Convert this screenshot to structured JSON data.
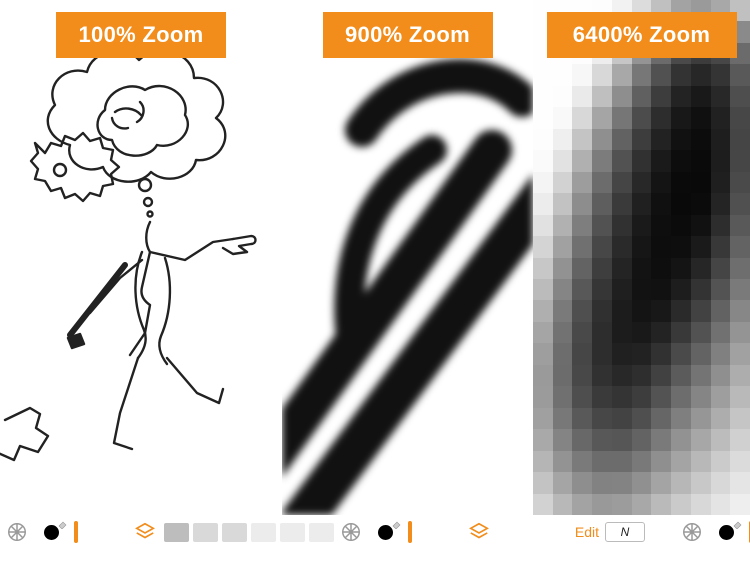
{
  "panels": [
    {
      "zoom_label": "100% Zoom"
    },
    {
      "zoom_label": "900% Zoom"
    },
    {
      "zoom_label": "6400% Zoom"
    }
  ],
  "toolbar": {
    "edit_label": "Edit",
    "n_label": "N"
  },
  "pixel_grid": {
    "cols": 11,
    "rows": 24,
    "shades": [
      "fefefe",
      "fefefe",
      "fefefe",
      "fdfdfd",
      "f2f2f2",
      "dcdcdc",
      "c0c0c0",
      "a3a3a3",
      "9a9a9a",
      "a8a8a8",
      "c0c0c0",
      "fefefe",
      "fefefe",
      "fefefe",
      "f8f8f8",
      "dedede",
      "b5b5b5",
      "8f8f8f",
      "6f6f6f",
      "616161",
      "6a6a6a",
      "8a8a8a",
      "fefefe",
      "fefefe",
      "fdfdfd",
      "ededed",
      "c6c6c6",
      "949494",
      "6b6b6b",
      "4a4a4a",
      "3c3c3c",
      "474747",
      "6b6b6b",
      "fefefe",
      "fefefe",
      "f7f7f7",
      "d8d8d8",
      "a8a8a8",
      "777777",
      "515151",
      "333333",
      "272727",
      "343434",
      "595959",
      "fefefe",
      "fdfdfd",
      "eaeaea",
      "bfbfbf",
      "8e8e8e",
      "606060",
      "3d3d3d",
      "232323",
      "191919",
      "282828",
      "4e4e4e",
      "fefefe",
      "f9f9f9",
      "d8d8d8",
      "a5a5a5",
      "767676",
      "4c4c4c",
      "2d2d2d",
      "181818",
      "101010",
      "212121",
      "474747",
      "fdfdfd",
      "efefef",
      "c4c4c4",
      "8f8f8f",
      "626262",
      "3d3d3d",
      "222222",
      "111111",
      "0c0c0c",
      "1e1e1e",
      "454545",
      "fafafa",
      "e2e2e2",
      "b0b0b0",
      "7c7c7c",
      "525252",
      "313131",
      "1a1a1a",
      "0d0d0d",
      "0a0a0a",
      "1d1d1d",
      "464646",
      "f4f4f4",
      "d2d2d2",
      "9d9d9d",
      "6c6c6c",
      "454545",
      "282828",
      "141414",
      "0a0a0a",
      "090909",
      "1f1f1f",
      "4a4a4a",
      "ececec",
      "c2c2c2",
      "8d8d8d",
      "5e5e5e",
      "3a3a3a",
      "202020",
      "101010",
      "090909",
      "0b0b0b",
      "242424",
      "505050",
      "e1e1e1",
      "b1b1b1",
      "7e7e7e",
      "525252",
      "313131",
      "1a1a1a",
      "0e0e0e",
      "0b0b0b",
      "111111",
      "2d2d2d",
      "595959",
      "d4d4d4",
      "a1a1a1",
      "707070",
      "474747",
      "2a2a2a",
      "161616",
      "0d0d0d",
      "0e0e0e",
      "1a1a1a",
      "383838",
      "636363",
      "c7c7c7",
      "929292",
      "636363",
      "3e3e3e",
      "242424",
      "131313",
      "0e0e0e",
      "141414",
      "262626",
      "454545",
      "6e6e6e",
      "bbbbbb",
      "858585",
      "585858",
      "363636",
      "1f1f1f",
      "121212",
      "111111",
      "1d1d1d",
      "333333",
      "535353",
      "7a7a7a",
      "afafaf",
      "7a7a7a",
      "4f4f4f",
      "303030",
      "1c1c1c",
      "141414",
      "181818",
      "2a2a2a",
      "424242",
      "626262",
      "878787",
      "a5a5a5",
      "727272",
      "494949",
      "2d2d2d",
      "1c1c1c",
      "191919",
      "232323",
      "393939",
      "525252",
      "717171",
      "949494",
      "9e9e9e",
      "6d6d6d",
      "464646",
      "2d2d2d",
      "202020",
      "222222",
      "313131",
      "4a4a4a",
      "636363",
      "808080",
      "a1a1a1",
      "9a9a9a",
      "6c6c6c",
      "484848",
      "313131",
      "282828",
      "2e2e2e",
      "414141",
      "5b5b5b",
      "747474",
      "8f8f8f",
      "adadad",
      "9b9b9b",
      "707070",
      "4e4e4e",
      "3a3a3a",
      "343434",
      "3d3d3d",
      "535353",
      "6d6d6d",
      "858585",
      "9e9e9e",
      "b9b9b9",
      "a0a0a0",
      "787878",
      "595959",
      "474747",
      "434343",
      "4f4f4f",
      "666666",
      "7f7f7f",
      "969696",
      "adadad",
      "c5c5c5",
      "a9a9a9",
      "848484",
      "686868",
      "585858",
      "565656",
      "636363",
      "7a7a7a",
      "929292",
      "a7a7a7",
      "bcbcbc",
      "d0d0d0",
      "b5b5b5",
      "939393",
      "7a7a7a",
      "6c6c6c",
      "6c6c6c",
      "797979",
      "8f8f8f",
      "a4a4a4",
      "b8b8b8",
      "cbcbcb",
      "dbdbdb",
      "c3c3c3",
      "a5a5a5",
      "8e8e8e",
      "828282",
      "838383",
      "909090",
      "a4a4a4",
      "b7b7b7",
      "c8c8c8",
      "d8d8d8",
      "e5e5e5",
      "d2d2d2",
      "b8b8b8",
      "a3a3a3",
      "999999",
      "9c9c9c",
      "a8a8a8",
      "bababa",
      "cacaca",
      "d8d8d8",
      "e4e4e4",
      "eeeeee"
    ]
  }
}
